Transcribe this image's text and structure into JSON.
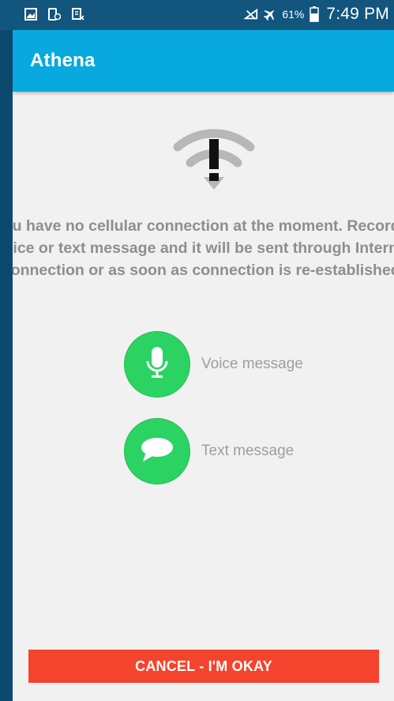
{
  "status_bar": {
    "battery_percent": "61%",
    "time": "7:49 PM"
  },
  "app_bar": {
    "title": "Athena"
  },
  "main": {
    "message": "You have no cellular connection at the moment. Record a voice or text message and it will be sent through Internet connection or as soon as connection is re-established.",
    "actions": {
      "voice_label": "Voice message",
      "text_label": "Text message"
    }
  },
  "footer": {
    "cancel_label": "CANCEL - I'M OKAY"
  },
  "colors": {
    "app_bar": "#08a9de",
    "action_green": "#2bd462",
    "cancel_red": "#f4442e",
    "background": "#f1f1f1"
  }
}
